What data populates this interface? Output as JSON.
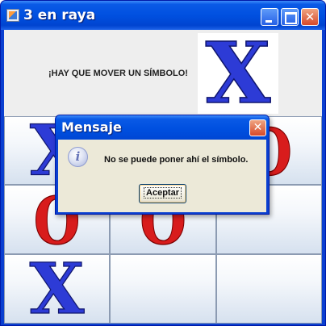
{
  "window": {
    "title": "3 en raya",
    "minimize_glyph": "",
    "maximize_glyph": "",
    "close_glyph": "✕"
  },
  "info": {
    "message": "¡HAY QUE MOVER UN SÍMBOLO!",
    "current_symbol": "X"
  },
  "board": {
    "cells": [
      "X",
      "",
      "O",
      "O",
      "O",
      "",
      "X",
      "",
      ""
    ]
  },
  "dialog": {
    "title": "Mensaje",
    "close_glyph": "✕",
    "icon": "information-icon",
    "icon_glyph": "i",
    "message": "No se puede poner ahí el símbolo.",
    "button_label": "Aceptar"
  },
  "colors": {
    "x_symbol": "#2d3bd6",
    "o_symbol": "#d81c1c",
    "titlebar": "#0050e0",
    "client_bg": "#ece9d8"
  }
}
